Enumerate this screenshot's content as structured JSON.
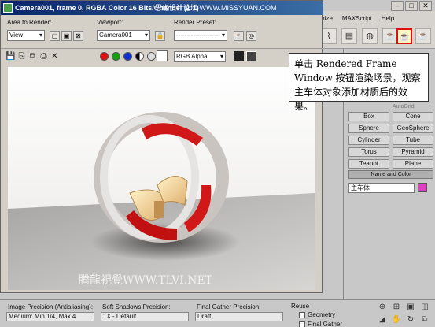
{
  "render_window": {
    "title": "Camera001, frame 0, RGBA Color 16 Bits/Channel (1:1)",
    "watermark_top": "思缘设计论坛  WWW.MISSYUAN.COM",
    "area_label": "Area to Render:",
    "area_value": "View",
    "viewport_label": "Viewport:",
    "viewport_value": "Camera001",
    "preset_label": "Render Preset:",
    "preset_value": "---------------------",
    "channel_value": "RGB Alpha",
    "watermark_bottom": "腾龍視覺WWW.TLVI.NET"
  },
  "menu": {
    "items": [
      "mize",
      "MAXScript",
      "Help"
    ]
  },
  "command_panel": {
    "object_type": "AutoGrid",
    "primitives": [
      "Box",
      "Cone",
      "Sphere",
      "GeoSphere",
      "Cylinder",
      "Tube",
      "Torus",
      "Pyramid",
      "Teapot",
      "Plane"
    ],
    "name_color_label": "Name and Color",
    "object_name": "主车体",
    "object_color": "#e040c0"
  },
  "callout": {
    "text": "单击 Rendered Frame Window 按钮渲染场景，观察主车体对象添加材质后的效果。"
  },
  "statusbar": {
    "image_precision_label": "Image Precision (Antialiasing):",
    "image_precision_value": "Medium: Min 1/4, Max 4",
    "soft_shadows_label": "Soft Shadows Precision:",
    "soft_shadows_value": "1X - Default",
    "final_gather_label": "Final Gather Precision:",
    "final_gather_value": "Draft",
    "reuse_label": "Reuse",
    "geometry_label": "Geometry",
    "final_gather_check_label": "Final Gather"
  },
  "colors": {
    "highlight": "#e01010",
    "title_bar": "#0a246a"
  }
}
